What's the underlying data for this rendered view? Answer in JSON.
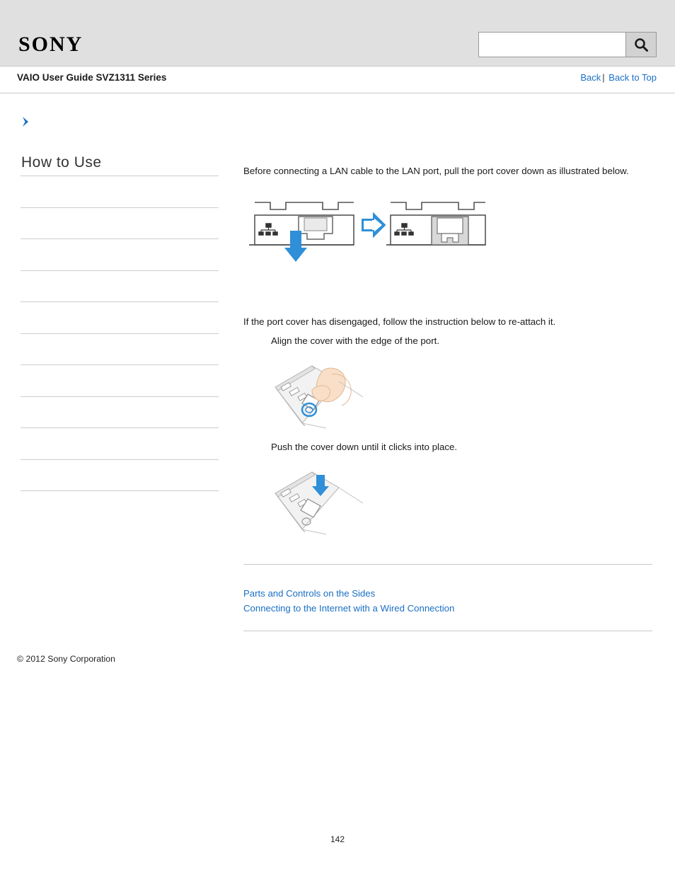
{
  "header": {
    "logo_text": "SONY",
    "search": {
      "value": "",
      "placeholder": "",
      "icon": "search-icon"
    }
  },
  "guide": {
    "title": "VAIO User Guide SVZ1311 Series",
    "back_label": "Back",
    "separator": "|",
    "back_to_top_label": "Back to Top"
  },
  "sidebar": {
    "expand_icon": "chevron-right-icon",
    "heading": "How to Use",
    "items": [
      {
        "label": ""
      },
      {
        "label": ""
      },
      {
        "label": ""
      },
      {
        "label": ""
      },
      {
        "label": ""
      },
      {
        "label": ""
      },
      {
        "label": ""
      },
      {
        "label": ""
      },
      {
        "label": ""
      },
      {
        "label": ""
      }
    ]
  },
  "main": {
    "intro": "Before connecting a LAN cable to the LAN port, pull the port cover down as illustrated below.",
    "reattach_note": "If the port cover has disengaged, follow the instruction below to re-attach it.",
    "step1": "Align the cover with the edge of the port.",
    "step2": "Push the cover down until it clicks into place.",
    "figures": {
      "port_before_label": "lan-port-cover-closed-illustration",
      "port_after_label": "lan-port-cover-open-illustration",
      "arrow_label": "right-arrow-icon",
      "photo1_label": "align-cover-photo",
      "photo2_label": "push-cover-photo"
    }
  },
  "related": {
    "links": [
      "Parts and Controls on the Sides",
      "Connecting to the Internet with a Wired Connection"
    ]
  },
  "footer": {
    "copyright": "© 2012 Sony Corporation",
    "page_number": "142"
  },
  "colors": {
    "link": "#1a6fc4",
    "header_bg": "#e0e0e0",
    "arrow_blue": "#2f8fd8"
  }
}
